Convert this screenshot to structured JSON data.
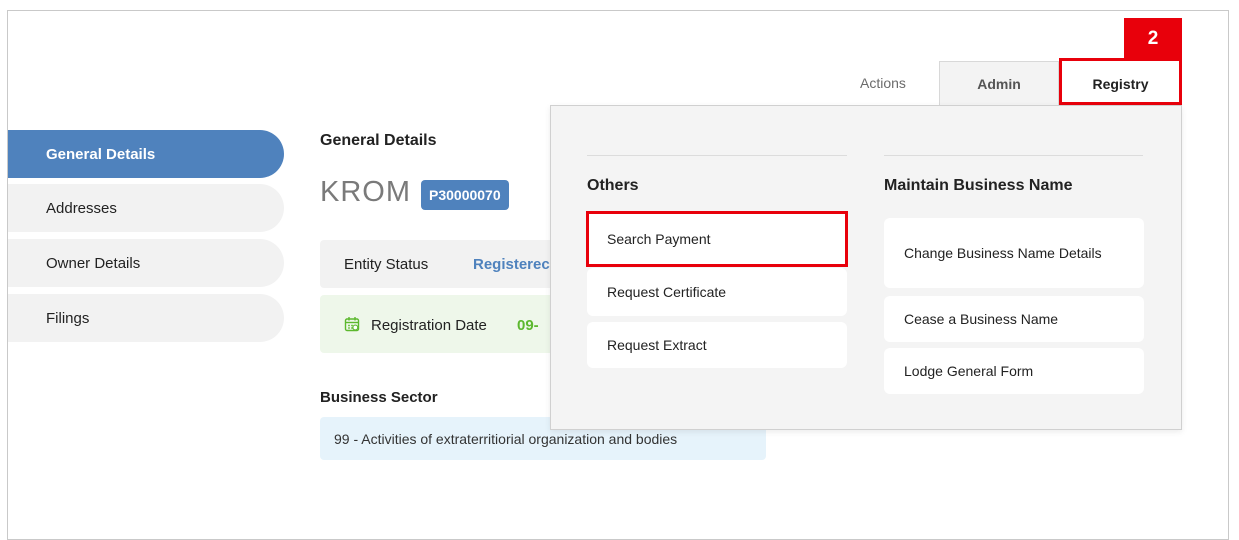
{
  "sidebar": {
    "items": [
      {
        "label": "General Details",
        "active": true
      },
      {
        "label": "Addresses"
      },
      {
        "label": "Owner Details"
      },
      {
        "label": "Filings"
      }
    ]
  },
  "main": {
    "section_title": "General Details",
    "entity_name": "KROM",
    "entity_number": "P30000070",
    "entity_status_label": "Entity Status",
    "entity_status_value": "Registerec",
    "registration_date_label": "Registration Date",
    "registration_date_value": "09-",
    "business_sector_title": "Business Sector",
    "business_sector_value": "99 - Activities of extraterritiorial organization and bodies"
  },
  "tabs": {
    "actions_label": "Actions",
    "admin_label": "Admin",
    "registry_label": "Registry"
  },
  "callout": {
    "step_number": "2"
  },
  "dropdown": {
    "others": {
      "heading": "Others",
      "items": [
        "Search Payment",
        "Request Certificate",
        "Request Extract"
      ]
    },
    "maintain": {
      "heading": "Maintain Business Name",
      "items": [
        "Change Business Name Details",
        "Cease a Business Name",
        "Lodge General Form"
      ]
    }
  },
  "colors": {
    "accent": "#4f82bd",
    "highlight": "#e8000b",
    "date_green": "#5cb82e"
  }
}
